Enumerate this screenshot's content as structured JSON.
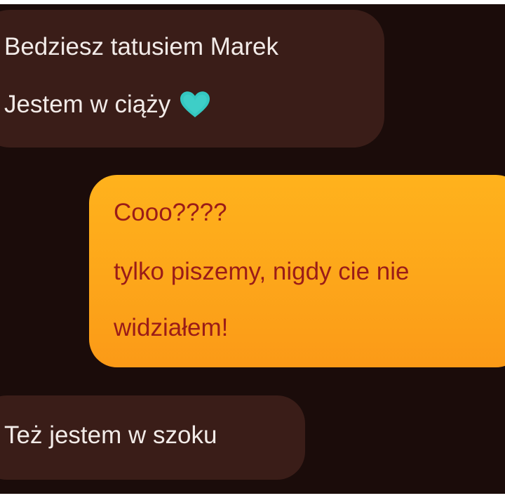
{
  "conversation": {
    "messages": [
      {
        "direction": "incoming",
        "lines": [
          "Bedziesz tatusiem Marek",
          "Jestem w ciąży"
        ],
        "emoji": "teal-heart-icon"
      },
      {
        "direction": "outgoing",
        "lines": [
          "Cooo????",
          "tylko piszemy, nigdy cie nie",
          "widziałem!"
        ]
      },
      {
        "direction": "incoming",
        "lines": [
          "Też jestem w szoku"
        ]
      }
    ]
  },
  "colors": {
    "background": "#1b0c0a",
    "incoming_bubble": "#3a1d18",
    "incoming_text": "#f2ebe8",
    "outgoing_bubble": "#fda61a",
    "outgoing_text": "#9a1c18",
    "heart": "#34c7c0"
  }
}
